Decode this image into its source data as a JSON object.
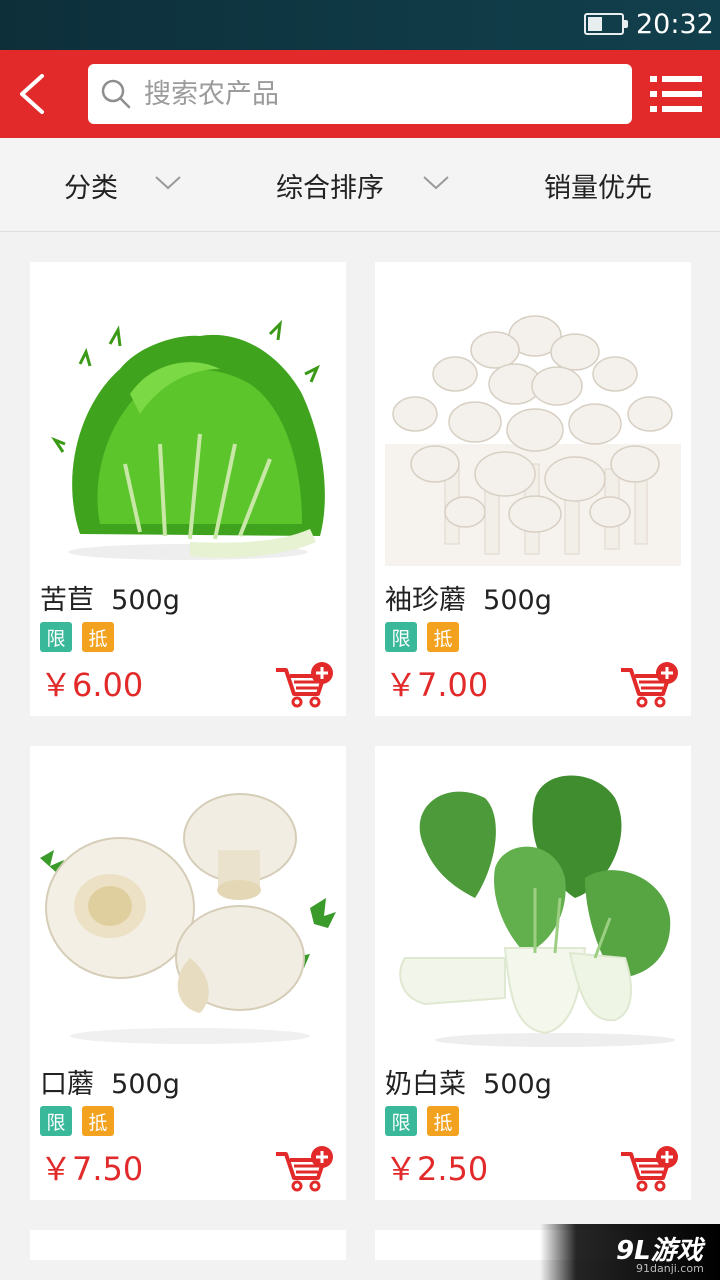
{
  "status_bar": {
    "time": "20:32",
    "battery_level": 0.4
  },
  "header": {
    "search_placeholder": "搜索农产品"
  },
  "filters": [
    {
      "label": "分类",
      "has_dropdown": true
    },
    {
      "label": "综合排序",
      "has_dropdown": true
    },
    {
      "label": "销量优先",
      "has_dropdown": false
    }
  ],
  "products": [
    {
      "name": "苦苣  500g",
      "tag_limit": "限",
      "tag_deduct": "抵",
      "price": "￥6.00",
      "image": "endive-image"
    },
    {
      "name": "袖珍蘑  500g",
      "tag_limit": "限",
      "tag_deduct": "抵",
      "price": "￥7.00",
      "image": "white-mushroom-image"
    },
    {
      "name": "口蘑  500g",
      "tag_limit": "限",
      "tag_deduct": "抵",
      "price": "￥7.50",
      "image": "button-mushroom-image"
    },
    {
      "name": "奶白菜  500g",
      "tag_limit": "限",
      "tag_deduct": "抵",
      "price": "￥2.50",
      "image": "bok-choy-image"
    }
  ],
  "watermark": {
    "logo": "9L游戏",
    "url": "91danji.com"
  },
  "colors": {
    "brand_red": "#e22a2a",
    "tag_green": "#39b89a",
    "tag_orange": "#f2a21f"
  }
}
